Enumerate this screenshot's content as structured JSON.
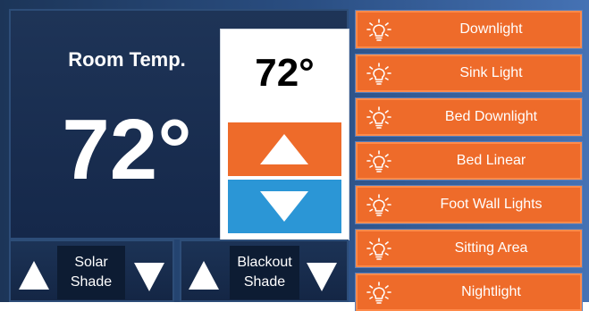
{
  "thermostat": {
    "room_label": "Room Temp.",
    "room_temp": "72°",
    "setpoint": "72°"
  },
  "shades": [
    {
      "line1": "Solar",
      "line2": "Shade"
    },
    {
      "line1": "Blackout",
      "line2": "Shade"
    }
  ],
  "lights": [
    {
      "label": "Downlight",
      "icon": "lightbulb-icon"
    },
    {
      "label": "Sink Light",
      "icon": "lightbulb-icon"
    },
    {
      "label": "Bed Downlight",
      "icon": "lightbulb-icon"
    },
    {
      "label": "Bed Linear",
      "icon": "lightbulb-icon"
    },
    {
      "label": "Foot Wall Lights",
      "icon": "lightbulb-icon"
    },
    {
      "label": "Sitting Area",
      "icon": "lightbulb-icon"
    },
    {
      "label": "Nightlight",
      "icon": "lightbulb-icon"
    }
  ],
  "colors": {
    "accent_orange": "#ee6b2a",
    "accent_blue": "#2b96d6",
    "panel_navy": "#1e3457"
  }
}
